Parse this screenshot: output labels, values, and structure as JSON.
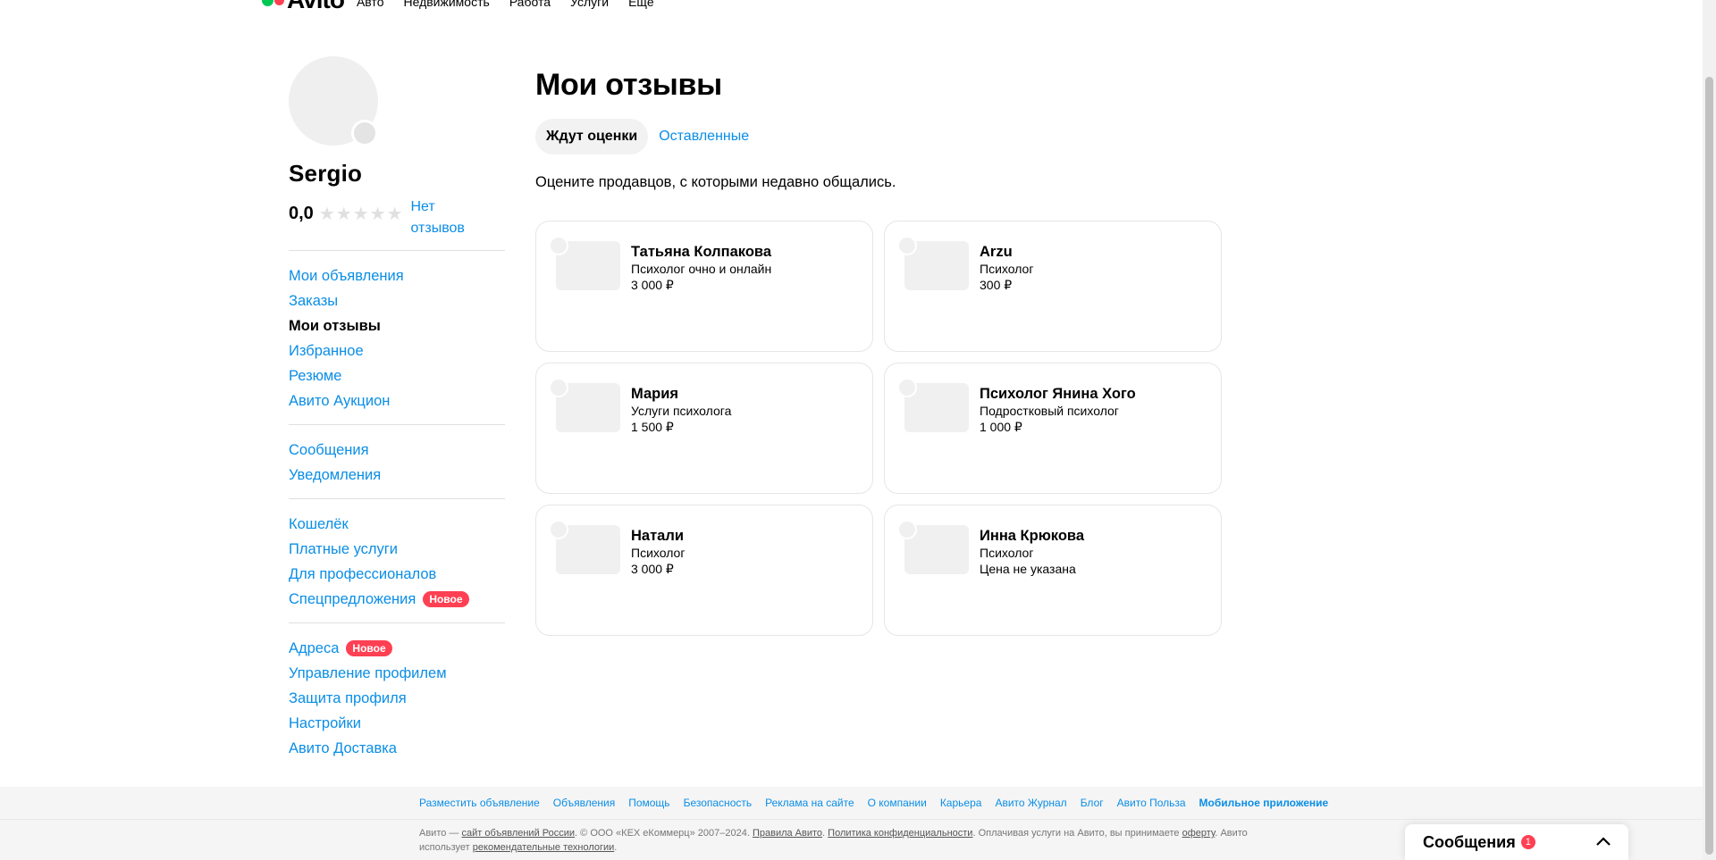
{
  "topnav": {
    "logo": "Avito",
    "items": [
      "Авто",
      "Недвижимость",
      "Работа",
      "Услуги",
      "Ещё"
    ]
  },
  "profile": {
    "name": "Sergio",
    "rating": "0,0",
    "stars_filled": 0,
    "stars_total": 5,
    "no_reviews": "Нет отзывов"
  },
  "sidebar": {
    "groups": [
      [
        {
          "label": "Мои объявления",
          "active": false
        },
        {
          "label": "Заказы",
          "active": false
        },
        {
          "label": "Мои отзывы",
          "active": true
        },
        {
          "label": "Избранное",
          "active": false
        },
        {
          "label": "Резюме",
          "active": false
        },
        {
          "label": "Авито Аукцион",
          "active": false
        }
      ],
      [
        {
          "label": "Сообщения",
          "active": false
        },
        {
          "label": "Уведомления",
          "active": false
        }
      ],
      [
        {
          "label": "Кошелёк",
          "active": false
        },
        {
          "label": "Платные услуги",
          "active": false
        },
        {
          "label": "Для профессионалов",
          "active": false
        },
        {
          "label": "Спецпредложения",
          "active": false,
          "badge": "Новое"
        }
      ],
      [
        {
          "label": "Адреса",
          "active": false,
          "badge": "Новое"
        },
        {
          "label": "Управление профилем",
          "active": false
        },
        {
          "label": "Защита профиля",
          "active": false
        },
        {
          "label": "Настройки",
          "active": false
        },
        {
          "label": "Авито Доставка",
          "active": false
        }
      ]
    ]
  },
  "main": {
    "title": "Мои отзывы",
    "tabs": [
      {
        "label": "Ждут оценки",
        "active": true
      },
      {
        "label": "Оставленные",
        "active": false
      }
    ],
    "subtitle": "Оцените продавцов, с которыми недавно общались.",
    "cards": [
      {
        "name": "Татьяна Колпакова",
        "desc": "Психолог очно и онлайн",
        "price": "3 000 ₽"
      },
      {
        "name": "Arzu",
        "desc": "Психолог",
        "price": "300 ₽"
      },
      {
        "name": "Мария",
        "desc": "Услуги психолога",
        "price": "1 500 ₽"
      },
      {
        "name": "Психолог Янина Хого",
        "desc": "Подростковый психолог",
        "price": "1 000 ₽"
      },
      {
        "name": "Натали",
        "desc": "Психолог",
        "price": "3 000 ₽"
      },
      {
        "name": "Инна Крюкова",
        "desc": "Психолог",
        "price": "Цена не указана"
      }
    ]
  },
  "footer": {
    "links": [
      {
        "label": "Разместить объявление",
        "bold": false
      },
      {
        "label": "Объявления",
        "bold": false
      },
      {
        "label": "Помощь",
        "bold": false
      },
      {
        "label": "Безопасность",
        "bold": false
      },
      {
        "label": "Реклама на сайте",
        "bold": false
      },
      {
        "label": "О компании",
        "bold": false
      },
      {
        "label": "Карьера",
        "bold": false
      },
      {
        "label": "Авито Журнал",
        "bold": false
      },
      {
        "label": "Блог",
        "bold": false
      },
      {
        "label": "Авито Польза",
        "bold": false
      },
      {
        "label": "Мобильное приложение",
        "bold": true
      }
    ],
    "legal": {
      "t1": "Авито — ",
      "l1": "сайт объявлений России",
      "t2": ". © ООО «КЕХ еКоммерц» 2007–2024. ",
      "l2": "Правила Авито",
      "t3": ". ",
      "l3": "Политика конфиденциальности",
      "t4": ". Оплачивая услуги на Авито, вы принимаете ",
      "l4": "оферту",
      "t5": ". Авито использует ",
      "l5": "рекомендательные технологии",
      "t6": "."
    }
  },
  "messages_widget": {
    "title": "Сообщения",
    "count": "1"
  },
  "colors": {
    "link": "#0a8ee6",
    "badge": "#ff4053",
    "logo_green": "#00c853",
    "logo_red": "#ff4053"
  }
}
